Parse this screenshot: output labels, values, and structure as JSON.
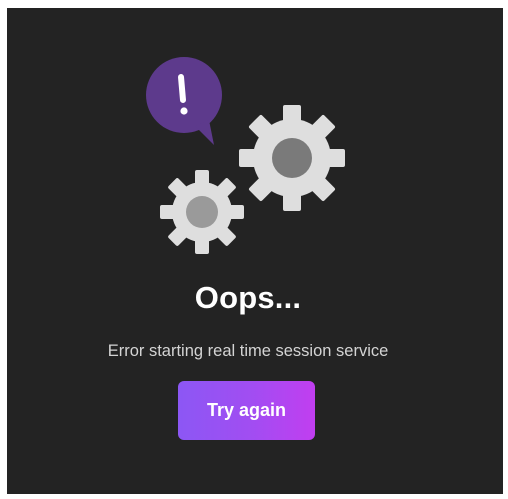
{
  "error": {
    "title": "Oops...",
    "message": "Error starting real time session service"
  },
  "actions": {
    "retry_label": "Try again"
  },
  "illustration": {
    "alert_icon": "exclamation-speech-bubble-icon",
    "gear_icon": "gear-icon"
  },
  "colors": {
    "background": "#232323",
    "bubble": "#5d3a8c",
    "gear": "#dedede",
    "gear_hub": "#7a7a7a",
    "button_gradient_start": "#8c57f4",
    "button_gradient_end": "#c13ef0"
  }
}
